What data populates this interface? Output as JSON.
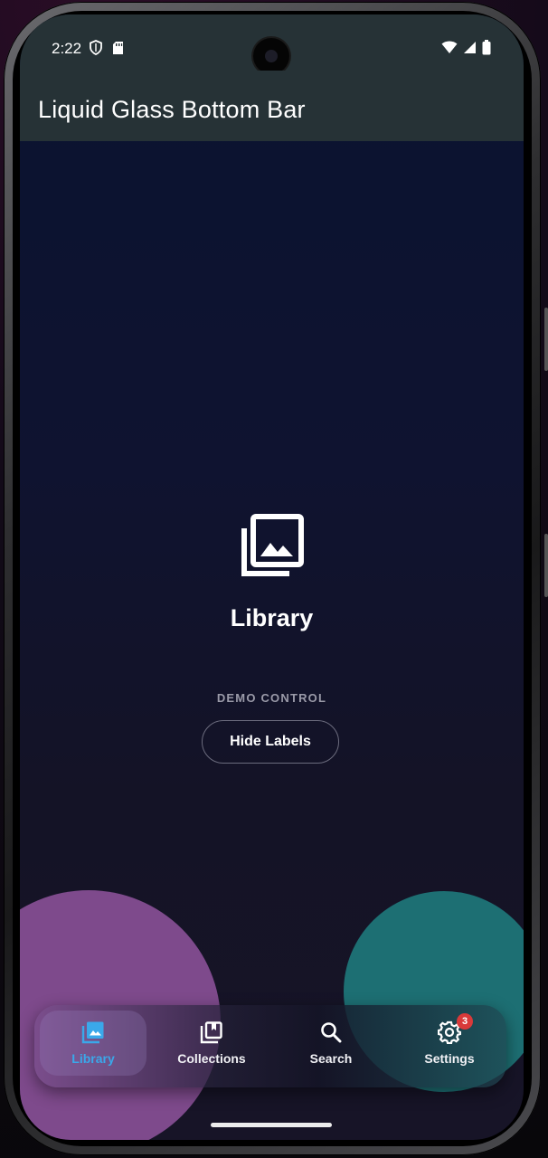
{
  "status_bar": {
    "time": "2:22",
    "left_icons": [
      "shield-icon",
      "sd-card-icon"
    ],
    "right_icons": [
      "wifi-icon",
      "signal-icon",
      "battery-icon"
    ]
  },
  "app_bar": {
    "title": "Liquid Glass Bottom Bar"
  },
  "main": {
    "heading": "Library",
    "heading_icon": "photo-library-icon",
    "demo_label": "DEMO CONTROL",
    "hide_labels_button": "Hide Labels"
  },
  "bottom_nav": {
    "items": [
      {
        "label": "Library",
        "icon": "photo-library-icon",
        "active": true
      },
      {
        "label": "Collections",
        "icon": "collections-bookmark-icon",
        "active": false
      },
      {
        "label": "Search",
        "icon": "search-icon",
        "active": false
      },
      {
        "label": "Settings",
        "icon": "gear-icon",
        "active": false,
        "badge": "3"
      }
    ]
  },
  "colors": {
    "app_bar": "#263236",
    "active_accent": "#3aa8ea",
    "badge": "#d93a3a",
    "purple_blob": "#7e4a8c",
    "teal_blob": "#1d6f73"
  }
}
